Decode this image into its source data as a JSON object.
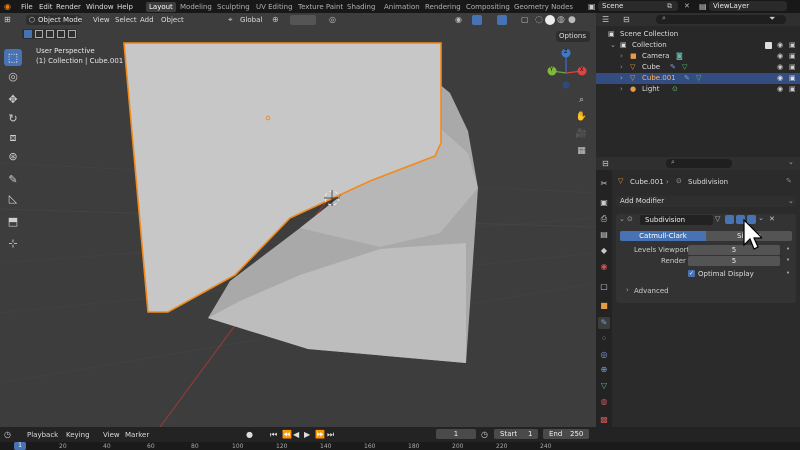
{
  "topbar": {
    "menus": [
      "File",
      "Edit",
      "Render",
      "Window",
      "Help"
    ],
    "workspaces": [
      "Layout",
      "Modeling",
      "Sculpting",
      "UV Editing",
      "Texture Paint",
      "Shading",
      "Animation",
      "Rendering",
      "Compositing",
      "Geometry Nodes"
    ],
    "active_workspace": "Layout",
    "scene_label": "Scene",
    "viewlayer_label": "ViewLayer"
  },
  "viewport": {
    "mode": "Object Mode",
    "menus": [
      "View",
      "Select",
      "Add",
      "Object"
    ],
    "transform_orientation": "Global",
    "info_line1": "User Perspective",
    "info_line2": "(1) Collection | Cube.001",
    "options_label": "Options",
    "gizmo_axes": [
      "X",
      "Y",
      "Z"
    ],
    "accent_color": "#f28a1b",
    "select_color": "#4772b3"
  },
  "outliner": {
    "scene_collection": "Scene Collection",
    "collection": "Collection",
    "items": [
      {
        "label": "Camera",
        "icon": "camera-icon"
      },
      {
        "label": "Cube",
        "icon": "mesh-icon"
      },
      {
        "label": "Cube.001",
        "icon": "mesh-icon",
        "selected": true
      },
      {
        "label": "Light",
        "icon": "light-icon"
      }
    ]
  },
  "properties": {
    "breadcrumb_object": "Cube.001",
    "breadcrumb_modifier": "Subdivision",
    "add_modifier": "Add Modifier",
    "modifier_name": "Subdivision",
    "method_catmull": "Catmull-Clark",
    "method_simple": "Simple",
    "levels_viewport_label": "Levels Viewport",
    "levels_viewport_value": "5",
    "render_label": "Render",
    "render_value": "5",
    "optimal_display_label": "Optimal Display",
    "optimal_display_checked": true,
    "advanced_label": "Advanced"
  },
  "timeline": {
    "menus": [
      "Playback",
      "Keying",
      "View",
      "Marker"
    ],
    "current_frame": "1",
    "start_label": "Start",
    "start_value": "1",
    "end_label": "End",
    "end_value": "250",
    "ruler": [
      "1",
      "20",
      "40",
      "60",
      "80",
      "100",
      "120",
      "140",
      "160",
      "180",
      "200",
      "220",
      "240"
    ]
  }
}
